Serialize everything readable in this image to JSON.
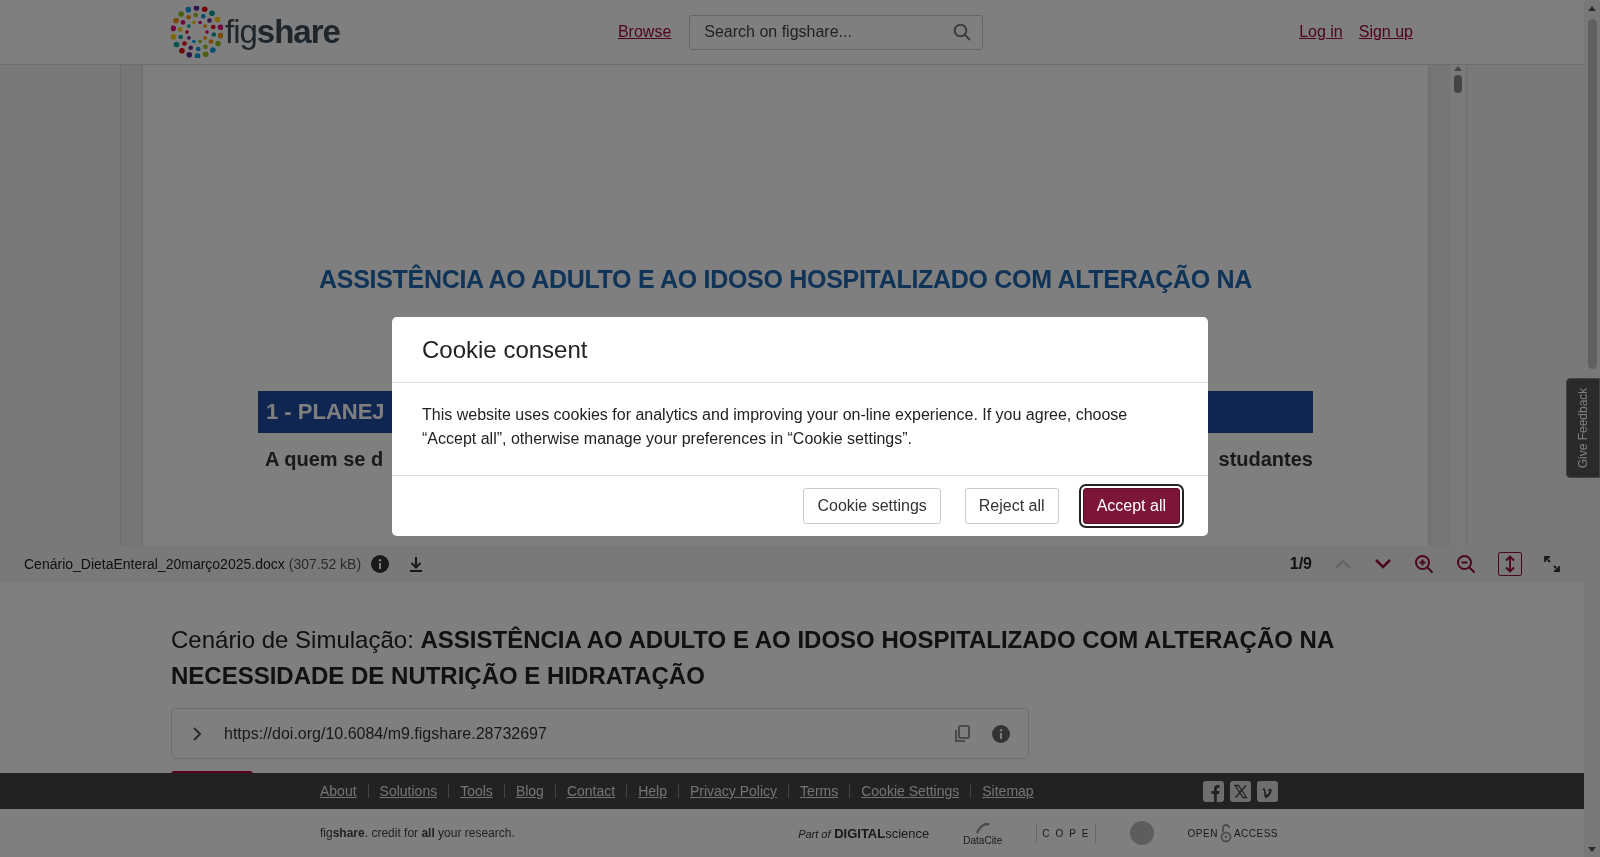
{
  "header": {
    "logo_text": "figshare",
    "nav_link": "Browse",
    "search": {
      "placeholder": "Search on figshare..."
    },
    "auth_links": [
      "Log in",
      "Sign up"
    ]
  },
  "document_preview": {
    "title_lines": [
      "ASSISTÊNCIA AO ADULTO E AO IDOSO HOSPITALIZADO COM ALTERAÇÃO NA"
    ],
    "section_heading": "1 - PLANEJ",
    "line_start": "A quem se d",
    "line_end": "studantes"
  },
  "viewer_toolbar": {
    "file_name": "Cenário_DietaEnteral_20março2025.docx",
    "file_size": "(307.52 kB)",
    "page": "1/9",
    "previous_disabled": true,
    "fit_height_selected": true
  },
  "article": {
    "title": "Cenário de Simulação: **ASSISTÊNCIA AO ADULTO E AO IDOSO HOSPITALIZADO COM ALTERAÇÃO NA NECESSIDADE DE NUTRIÇÃO E HIDRATAÇÃO**",
    "doi": "https://doi.org/10.6084/m9.figshare.28732697"
  },
  "footer": {
    "links": [
      "About",
      "Solutions",
      "Tools",
      "Blog",
      "Contact",
      "Help",
      "Privacy Policy",
      "Terms",
      "Cookie Settings",
      "Sitemap"
    ],
    "tagline": "fig**share**. credit for **all** your research.",
    "partners": [
      {
        "kind": "digital-science",
        "text": "*Part of* **DIGITAL**science"
      },
      {
        "kind": "datacite",
        "text": "DataCite"
      },
      {
        "kind": "cope",
        "text": "COPE"
      },
      {
        "kind": "seal"
      },
      {
        "kind": "open-access",
        "left": "OPEN",
        "right": "ACCESS"
      }
    ]
  },
  "feedback": {
    "label": "Give Feedback"
  },
  "cookie_modal": {
    "title": "Cookie consent",
    "body": "This website uses cookies for analytics and improving your on-line experience. If you agree, choose “Accept all”, otherwise manage your preferences in “Cookie settings”.",
    "buttons": [
      {
        "label": "Cookie settings",
        "kind": "secondary",
        "focused": false
      },
      {
        "label": "Reject all",
        "kind": "secondary",
        "focused": false
      },
      {
        "label": "Accept all",
        "kind": "primary",
        "focused": true
      }
    ]
  }
}
